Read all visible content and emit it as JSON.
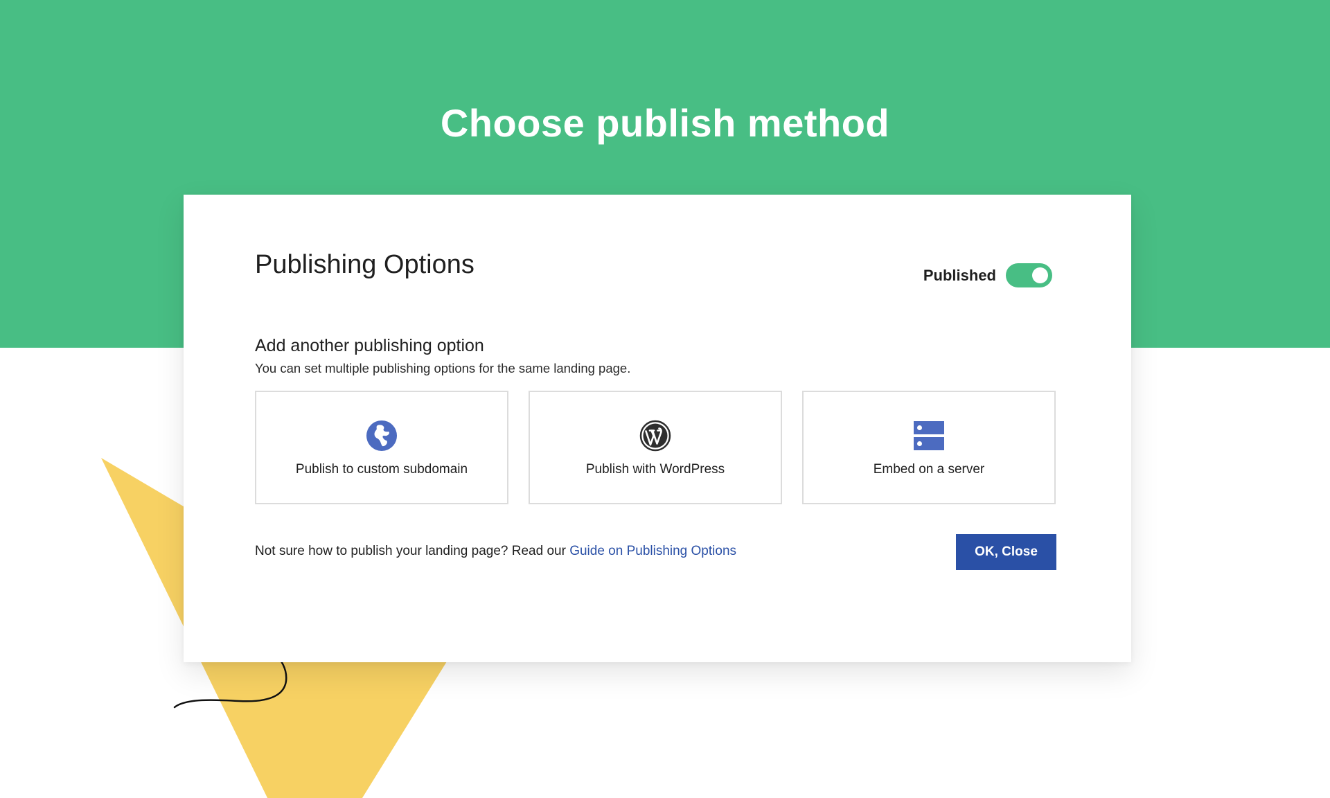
{
  "page": {
    "heading": "Choose publish method"
  },
  "modal": {
    "title": "Publishing Options",
    "status_label": "Published",
    "status_on": true,
    "section_title": "Add another publishing option",
    "section_subtitle": "You can set multiple publishing options for the same landing page.",
    "options": [
      {
        "label": "Publish to custom subdomain",
        "icon": "globe-icon"
      },
      {
        "label": "Publish with WordPress",
        "icon": "wordpress-icon"
      },
      {
        "label": "Embed on a server",
        "icon": "server-icon"
      }
    ],
    "help_text": "Not sure how to publish your landing page? Read our ",
    "help_link": "Guide on Publishing Options",
    "ok_button": "OK, Close"
  },
  "colors": {
    "brand_green": "#48be84",
    "accent_blue": "#2a50a6",
    "icon_blue": "#4c6bc0",
    "decor_yellow": "#f7d163"
  }
}
